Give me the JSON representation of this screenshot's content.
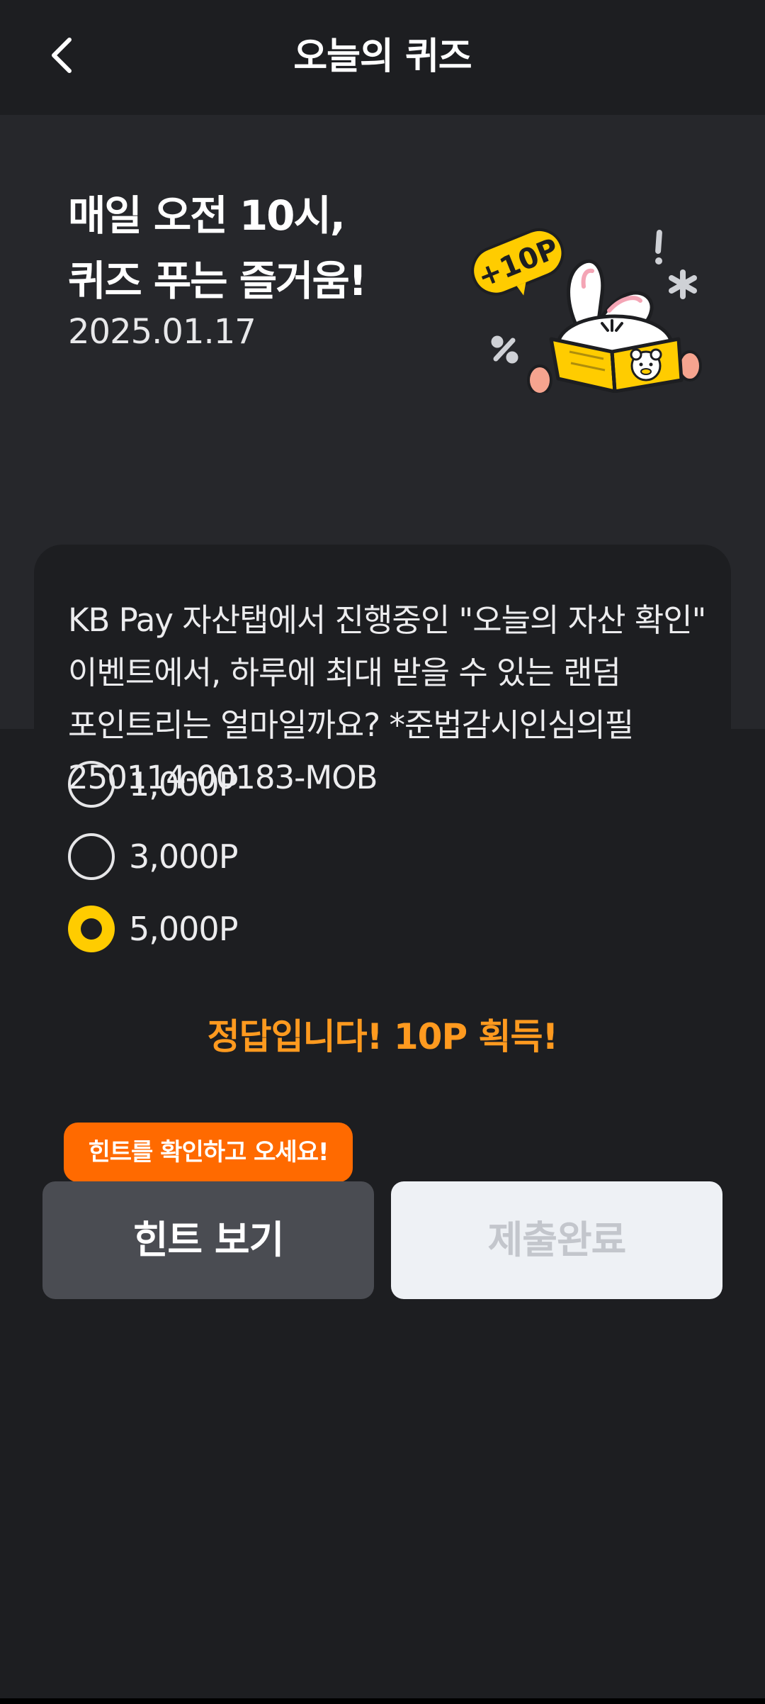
{
  "header": {
    "title": "오늘의 퀴즈"
  },
  "banner": {
    "headline_line1": "매일 오전 10시,",
    "headline_line2": "퀴즈 푸는 즐거움!",
    "date": "2025.01.17",
    "badge": "+10P"
  },
  "quiz": {
    "question": "KB Pay 자산탭에서 진행중인 \"오늘의 자산 확인\" 이벤트에서, 하루에 최대 받을 수 있는 랜덤 포인트리는 얼마일까요? *준법감시인심의필 250114-00183-MOB",
    "options": [
      {
        "label": "1,000P",
        "selected": false
      },
      {
        "label": "3,000P",
        "selected": false
      },
      {
        "label": "5,000P",
        "selected": true
      }
    ],
    "result": "정답입니다! 10P 획득!"
  },
  "actions": {
    "hint_tooltip": "힌트를 확인하고 오세요!",
    "hint_label": "힌트 보기",
    "submit_label": "제출완료"
  },
  "colors": {
    "accent_yellow": "#ffcc00",
    "result_orange": "#ff9a1f",
    "tooltip_orange": "#ff6a00"
  }
}
